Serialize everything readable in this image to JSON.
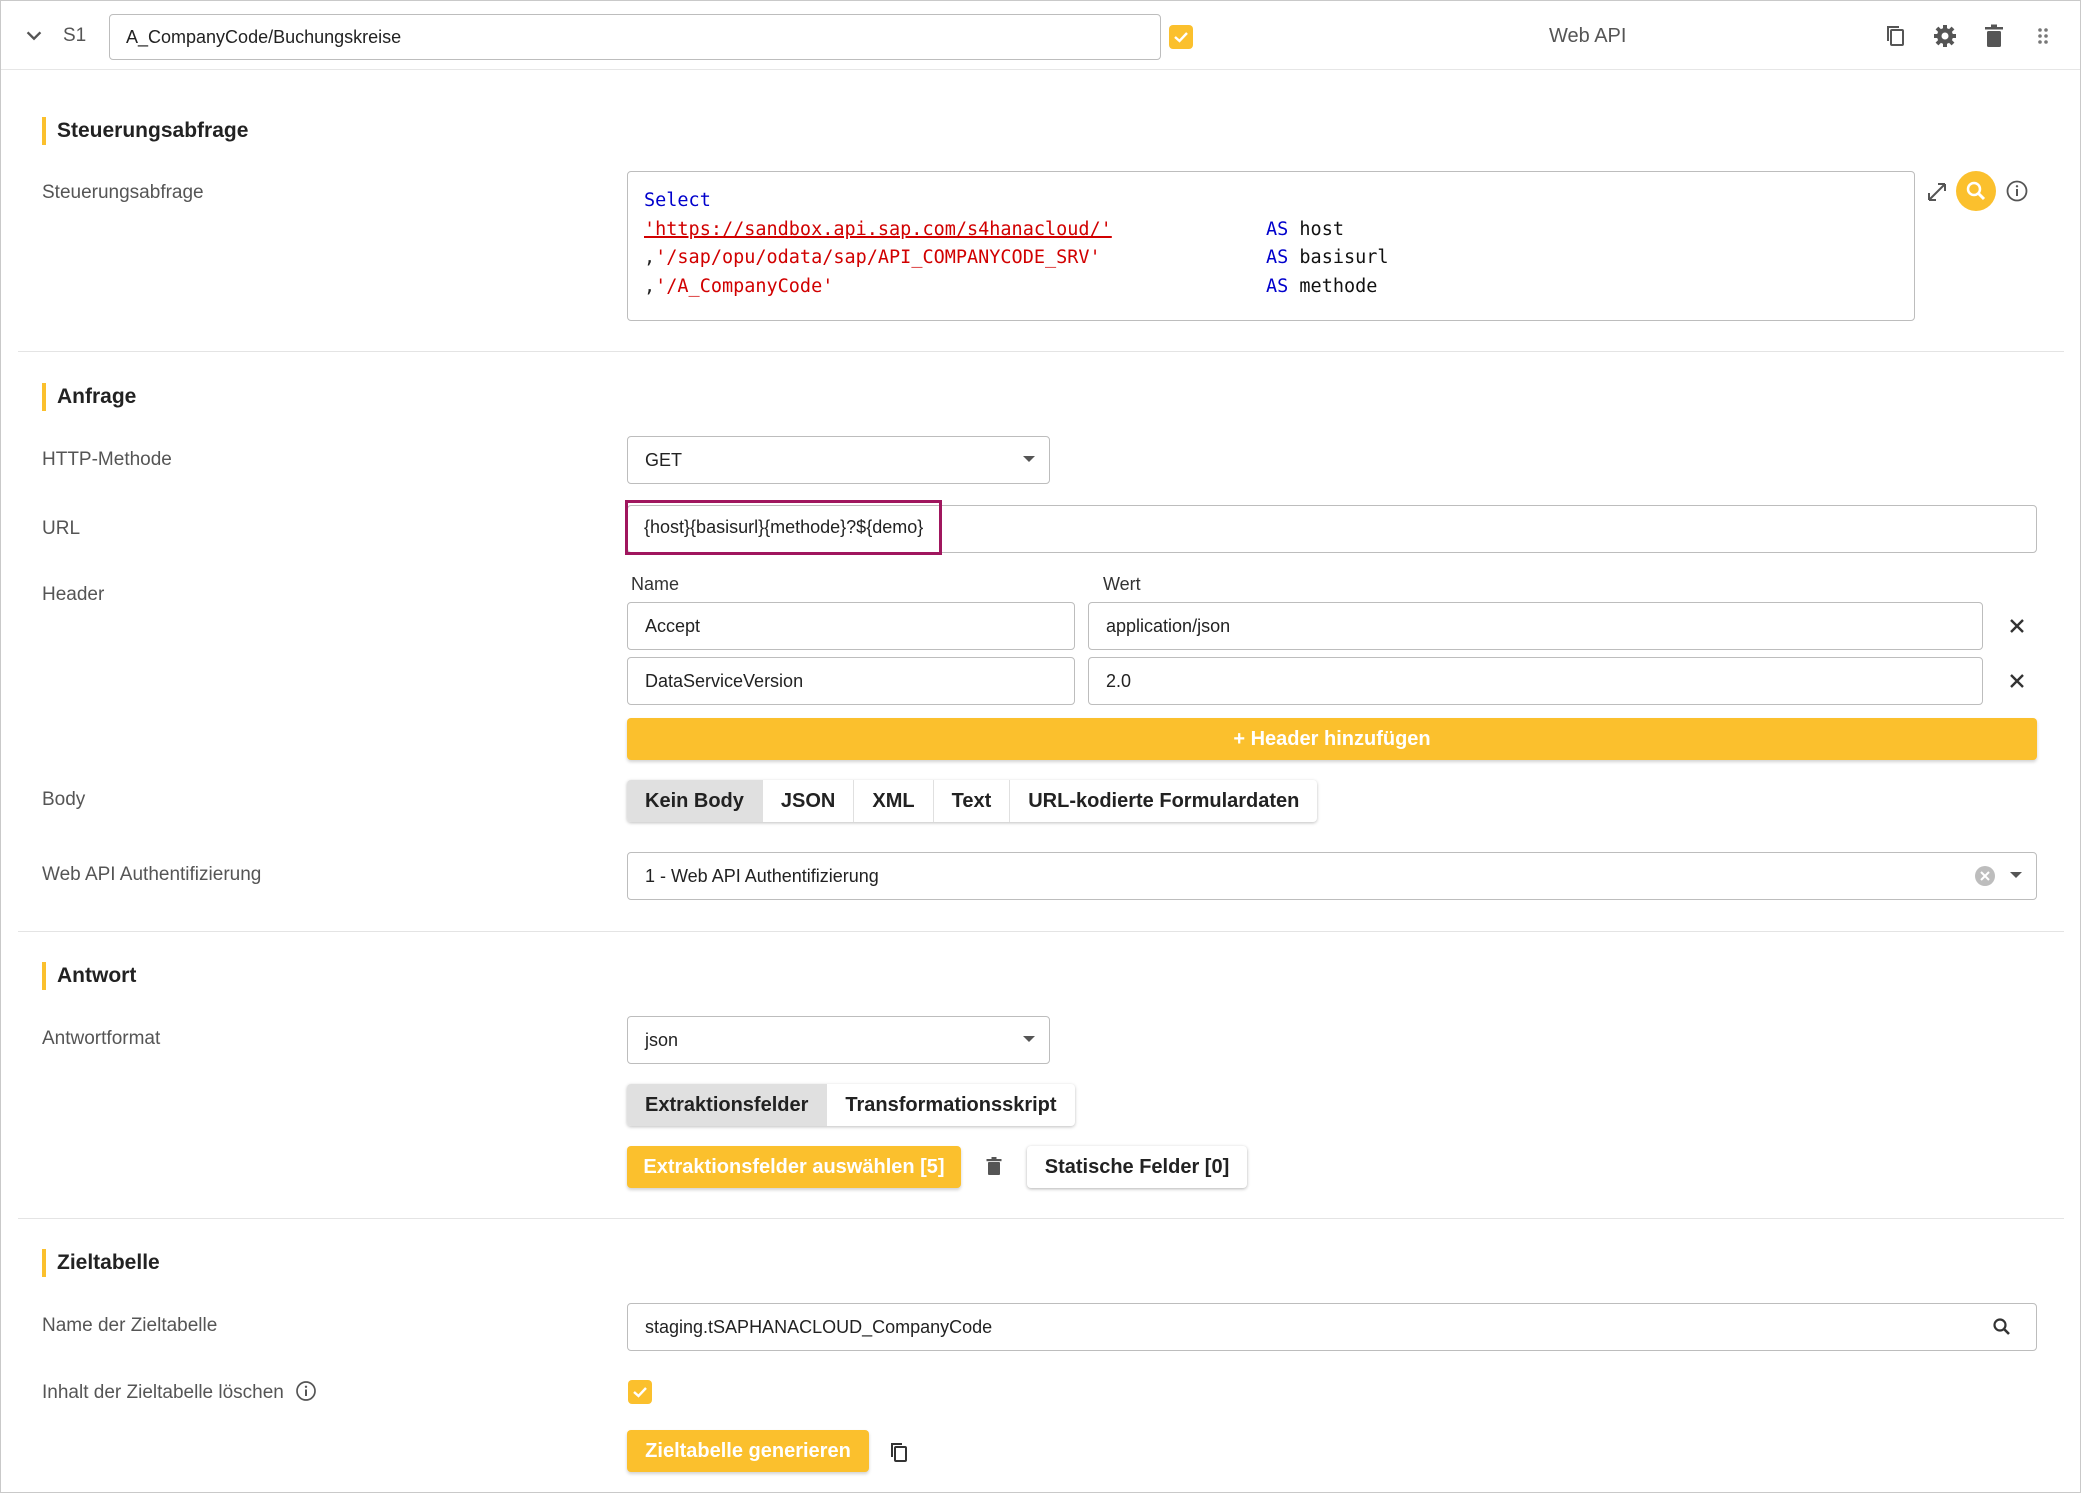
{
  "header": {
    "step_id": "S1",
    "step_name": "A_CompanyCode/Buchungskreise",
    "step_type": "Web API",
    "icons": [
      "copy-icon",
      "gear-icon",
      "trash-icon",
      "drag-handle-icon"
    ]
  },
  "sections": {
    "control": {
      "title": "Steuerungsabfrage",
      "field_label": "Steuerungsabfrage",
      "code": {
        "line1_kw": "Select",
        "line2_str": "'https://sandbox.api.sap.com/s4hanacloud/'",
        "line3_prefix": ",",
        "line3_str": "'/sap/opu/odata/sap/API_COMPANYCODE_SRV'",
        "line4_prefix": ",",
        "line4_str": "'/A_CompanyCode'",
        "as_kw": "AS",
        "alias1": "host",
        "alias2": "basisurl",
        "alias3": "methode"
      }
    },
    "request": {
      "title": "Anfrage",
      "method_label": "HTTP-Methode",
      "method_value": "GET",
      "url_label": "URL",
      "url_value": "{host}{basisurl}{methode}?${demo}",
      "header_label": "Header",
      "header_col_name": "Name",
      "header_col_value": "Wert",
      "headers": [
        {
          "name": "Accept",
          "value": "application/json"
        },
        {
          "name": "DataServiceVersion",
          "value": "2.0"
        }
      ],
      "add_header": "+ Header hinzufügen",
      "body_label": "Body",
      "body_options": [
        "Kein Body",
        "JSON",
        "XML",
        "Text",
        "URL-kodierte Formulardaten"
      ],
      "auth_label": "Web API Authentifizierung",
      "auth_value": "1 - Web API Authentifizierung"
    },
    "response": {
      "title": "Antwort",
      "format_label": "Antwortformat",
      "format_value": "json",
      "tabs": [
        "Extraktionsfelder",
        "Transformationsskript"
      ],
      "select_fields": "Extraktionsfelder auswählen [5]",
      "static_fields": "Statische Felder [0]"
    },
    "target": {
      "title": "Zieltabelle",
      "name_label": "Name der Zieltabelle",
      "name_value": "staging.tSAPHANACLOUD_CompanyCode",
      "clear_label": "Inhalt der Zieltabelle löschen",
      "generate": "Zieltabelle generieren"
    }
  },
  "colors": {
    "accent": "#fbc02d",
    "highlight_border": "#a0165e",
    "keyword": "#0000cc",
    "string": "#d10000"
  }
}
